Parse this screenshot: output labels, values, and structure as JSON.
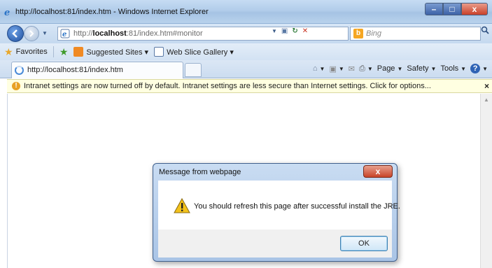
{
  "window": {
    "title": "http://localhost:81/index.htm - Windows Internet Explorer",
    "min_glyph": "–",
    "max_glyph": "□",
    "close_glyph": "x"
  },
  "navigation": {
    "address_url_prefix": "http://",
    "address_url_host": "localhost",
    "address_url_suffix": ":81/index.htm#monitor",
    "search_placeholder": "Bing",
    "search_icon": "magnifier-icon"
  },
  "favorites_bar": {
    "favorites_label": "Favorites",
    "suggested_sites_label": "Suggested Sites ▾",
    "web_slice_gallery_label": "Web Slice Gallery ▾"
  },
  "tabs": [
    {
      "label": "http://localhost:81/index.htm",
      "icon": "loading-icon"
    }
  ],
  "command_bar": {
    "page_label": "Page",
    "safety_label": "Safety",
    "tools_label": "Tools",
    "help_label": "?"
  },
  "info_bar": {
    "message": "Intranet settings are now turned off by default. Intranet settings are less secure than Internet settings. Click for options...",
    "close_label": "×"
  },
  "dialog": {
    "title": "Message from webpage",
    "close_label": "x",
    "message": "You should refresh this page after successful install the JRE.",
    "ok_label": "OK",
    "icon": "warning-icon"
  },
  "colors": {
    "dialog_border": "#3f5f8c",
    "close_red": "#c84428",
    "info_bar_bg": "#ffffe1",
    "ok_border": "#3c7fb1"
  }
}
